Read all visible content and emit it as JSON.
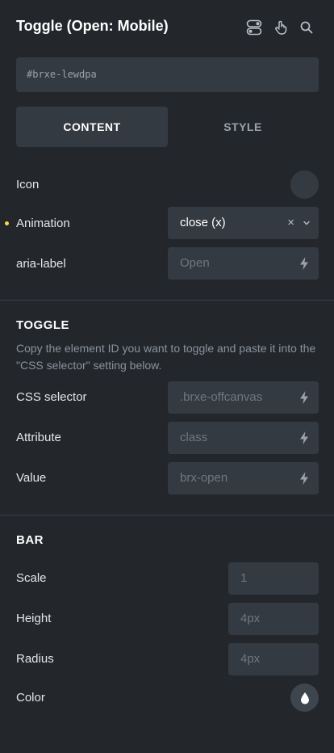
{
  "header": {
    "title": "Toggle (Open: Mobile)",
    "icons": [
      "toggle-switch-icon",
      "hand-pointer-icon",
      "search-icon"
    ]
  },
  "element_id": "#brxe-lewdpa",
  "tabs": [
    {
      "label": "CONTENT",
      "active": true
    },
    {
      "label": "STYLE",
      "active": false
    }
  ],
  "content": {
    "icon_label": "Icon",
    "animation_label": "Animation",
    "animation_value": "close (x)",
    "animation_clear": "×",
    "aria_label": "aria-label",
    "aria_placeholder": "Open"
  },
  "toggle_section": {
    "title": "TOGGLE",
    "description": "Copy the element ID you want to toggle and paste it into the \"CSS selector\" setting below.",
    "css_selector_label": "CSS selector",
    "css_selector_placeholder": ".brxe-offcanvas",
    "attribute_label": "Attribute",
    "attribute_placeholder": "class",
    "value_label": "Value",
    "value_placeholder": "brx-open"
  },
  "bar_section": {
    "title": "BAR",
    "scale_label": "Scale",
    "scale_placeholder": "1",
    "height_label": "Height",
    "height_placeholder": "4px",
    "radius_label": "Radius",
    "radius_placeholder": "4px",
    "color_label": "Color"
  },
  "colors": {
    "background": "#23272c",
    "field": "#343a41",
    "modified_dot": "#ffd64f"
  }
}
